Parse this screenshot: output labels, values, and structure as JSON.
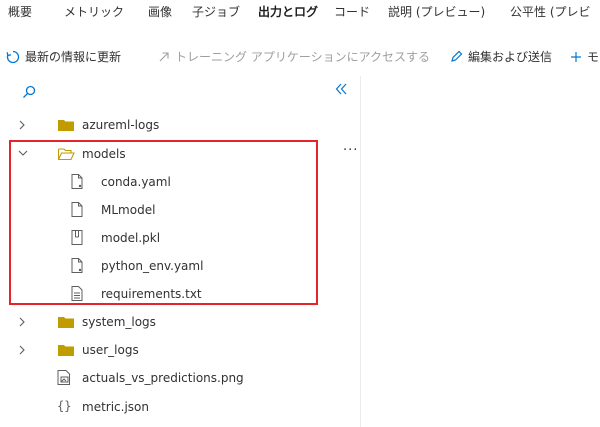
{
  "tabs": [
    {
      "label": "概要"
    },
    {
      "label": "メトリック"
    },
    {
      "label": "画像"
    },
    {
      "label": "子ジョブ"
    },
    {
      "label": "出力とログ",
      "active": true
    },
    {
      "label": "コード"
    },
    {
      "label": "説明 (プレビュー)"
    },
    {
      "label": "公平性 (プレビ"
    }
  ],
  "toolbar": {
    "refresh_label": "最新の情報に更新",
    "training_app_label": "トレーニング アプリケーションにアクセスする",
    "edit_submit_label": "編集および送信",
    "add_label": "モ"
  },
  "tree": {
    "azureml_logs": "azureml-logs",
    "models": "models",
    "conda_yaml": "conda.yaml",
    "mlmodel": "MLmodel",
    "model_pkl": "model.pkl",
    "python_env_yaml": "python_env.yaml",
    "requirements_txt": "requirements.txt",
    "system_logs": "system_logs",
    "user_logs": "user_logs",
    "actuals_png": "actuals_vs_predictions.png",
    "metric_json": "metric.json",
    "more_glyph": "···",
    "json_glyph": "{}"
  },
  "colors": {
    "accent": "#0078d4",
    "folder": "#c19c00",
    "highlight_border": "#e3262b",
    "disabled_text": "#a19f9d"
  }
}
